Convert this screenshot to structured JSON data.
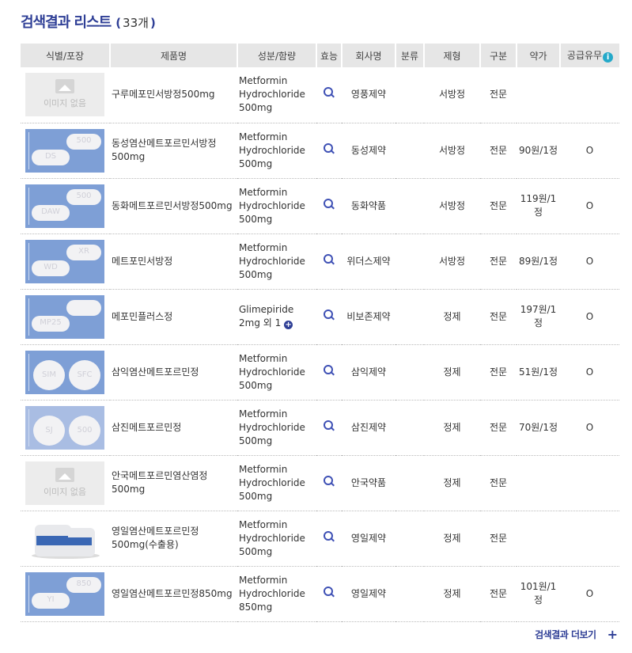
{
  "header": {
    "title": "검색결과 리스트",
    "count_open": "(",
    "count": "33개",
    "count_close": ")"
  },
  "columns": [
    "식별/포장",
    "제품명",
    "성분/함량",
    "효능",
    "회사명",
    "분류",
    "제형",
    "구분",
    "약가",
    "공급유무"
  ],
  "no_image_text": "이미지 없음",
  "rows": [
    {
      "image": "none",
      "name": "구루메포민서방정500mg",
      "ingredient": "Metformin Hydrochloride 500mg",
      "company": "영풍제약",
      "category": "",
      "form": "서방정",
      "type": "전문",
      "price": "",
      "supply": ""
    },
    {
      "image": "pill",
      "imprints": [
        "500",
        "DS"
      ],
      "name": "동성염산메트포르민서방정500mg",
      "ingredient": "Metformin Hydrochloride 500mg",
      "company": "동성제약",
      "category": "",
      "form": "서방정",
      "type": "전문",
      "price": "90원/1정",
      "supply": "O"
    },
    {
      "image": "pill",
      "imprints": [
        "500",
        "DAW"
      ],
      "name": "동화메트포르민서방정500mg",
      "ingredient": "Metformin Hydrochloride 500mg",
      "company": "동화약품",
      "category": "",
      "form": "서방정",
      "type": "전문",
      "price": "119원/1정",
      "supply": "O"
    },
    {
      "image": "pill",
      "imprints": [
        "XR",
        "WD"
      ],
      "name": "메트포민서방정",
      "ingredient": "Metformin Hydrochloride 500mg",
      "company": "위더스제약",
      "category": "",
      "form": "서방정",
      "type": "전문",
      "price": "89원/1정",
      "supply": "O"
    },
    {
      "image": "pill",
      "imprints": [
        "",
        "MP25"
      ],
      "name": "메포민플러스정",
      "ingredient": "Glimepiride 2mg 외 1",
      "ingredient_more": "+",
      "company": "비보존제약",
      "category": "",
      "form": "정제",
      "type": "전문",
      "price": "197원/1정",
      "supply": "O"
    },
    {
      "image": "round",
      "imprints": [
        "SIM",
        "SFC"
      ],
      "name": "삼익염산메트포르민정",
      "ingredient": "Metformin Hydrochloride 500mg",
      "company": "삼익제약",
      "category": "",
      "form": "정제",
      "type": "전문",
      "price": "51원/1정",
      "supply": "O"
    },
    {
      "image": "round-white",
      "imprints": [
        "SJ",
        "500"
      ],
      "name": "삼진메트포르민정",
      "ingredient": "Metformin Hydrochloride 500mg",
      "company": "삼진제약",
      "category": "",
      "form": "정제",
      "type": "전문",
      "price": "70원/1정",
      "supply": "O"
    },
    {
      "image": "none",
      "name": "안국메트포르민염산염정500mg",
      "ingredient": "Metformin Hydrochloride 500mg",
      "company": "안국약품",
      "category": "",
      "form": "정제",
      "type": "전문",
      "price": "",
      "supply": ""
    },
    {
      "image": "bottle",
      "name": "영일염산메트포르민정500mg(수출용)",
      "ingredient": "Metformin Hydrochloride 500mg",
      "company": "영일제약",
      "category": "",
      "form": "정제",
      "type": "전문",
      "price": "",
      "supply": ""
    },
    {
      "image": "pill",
      "imprints": [
        "850",
        "YI"
      ],
      "name": "영일염산메트포르민정850mg",
      "ingredient": "Metformin Hydrochloride 850mg",
      "company": "영일제약",
      "category": "",
      "form": "정제",
      "type": "전문",
      "price": "101원/1정",
      "supply": "O"
    }
  ],
  "more_label": "검색결과 더보기",
  "more_icon": "plus-icon",
  "colors": {
    "accent": "#2f3f96",
    "header_bg": "#e6e6e6",
    "info": "#24a9c9"
  }
}
